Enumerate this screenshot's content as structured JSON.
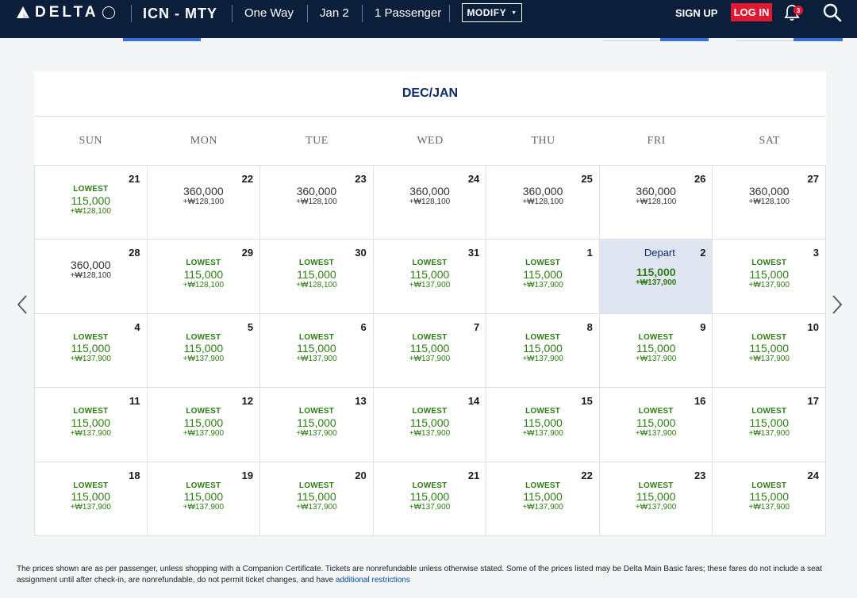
{
  "header": {
    "brand": "DELTA",
    "route": "ICN - MTY",
    "trip_type": "One Way",
    "date": "Jan 2",
    "passengers": "1 Passenger",
    "modify": "MODIFY",
    "signup": "SIGN UP",
    "login": "LOG IN",
    "notification_count": "3",
    "icons": [
      "delta-widget-icon",
      "delta-circle-icon",
      "bell-icon",
      "search-icon",
      "chevron-down-icon"
    ]
  },
  "calendar": {
    "month": "DEC/JAN",
    "days_of_week": [
      "SUN",
      "MON",
      "TUE",
      "WED",
      "THU",
      "FRI",
      "SAT"
    ],
    "lowest_label": "LOWEST",
    "selected_label": "Depart",
    "colors": {
      "green": "#2e7d14",
      "navy": "#0b2a6b",
      "selected_bg": "#dfe6f1"
    },
    "cells": [
      {
        "day": "21",
        "lowest": true,
        "miles": "115,000",
        "fee": "+₩128,100"
      },
      {
        "day": "22",
        "lowest": false,
        "miles": "360,000",
        "fee": "+₩128,100"
      },
      {
        "day": "23",
        "lowest": false,
        "miles": "360,000",
        "fee": "+₩128,100"
      },
      {
        "day": "24",
        "lowest": false,
        "miles": "360,000",
        "fee": "+₩128,100"
      },
      {
        "day": "25",
        "lowest": false,
        "miles": "360,000",
        "fee": "+₩128,100"
      },
      {
        "day": "26",
        "lowest": false,
        "miles": "360,000",
        "fee": "+₩128,100"
      },
      {
        "day": "27",
        "lowest": false,
        "miles": "360,000",
        "fee": "+₩128,100"
      },
      {
        "day": "28",
        "lowest": false,
        "miles": "360,000",
        "fee": "+₩128,100"
      },
      {
        "day": "29",
        "lowest": true,
        "miles": "115,000",
        "fee": "+₩128,100"
      },
      {
        "day": "30",
        "lowest": true,
        "miles": "115,000",
        "fee": "+₩128,100"
      },
      {
        "day": "31",
        "lowest": true,
        "miles": "115,000",
        "fee": "+₩137,900"
      },
      {
        "day": "1",
        "lowest": true,
        "miles": "115,000",
        "fee": "+₩137,900"
      },
      {
        "day": "2",
        "selected": true,
        "miles": "115,000",
        "fee": "+₩137,900"
      },
      {
        "day": "3",
        "lowest": true,
        "miles": "115,000",
        "fee": "+₩137,900"
      },
      {
        "day": "4",
        "lowest": true,
        "miles": "115,000",
        "fee": "+₩137,900"
      },
      {
        "day": "5",
        "lowest": true,
        "miles": "115,000",
        "fee": "+₩137,900"
      },
      {
        "day": "6",
        "lowest": true,
        "miles": "115,000",
        "fee": "+₩137,900"
      },
      {
        "day": "7",
        "lowest": true,
        "miles": "115,000",
        "fee": "+₩137,900"
      },
      {
        "day": "8",
        "lowest": true,
        "miles": "115,000",
        "fee": "+₩137,900"
      },
      {
        "day": "9",
        "lowest": true,
        "miles": "115,000",
        "fee": "+₩137,900"
      },
      {
        "day": "10",
        "lowest": true,
        "miles": "115,000",
        "fee": "+₩137,900"
      },
      {
        "day": "11",
        "lowest": true,
        "miles": "115,000",
        "fee": "+₩137,900"
      },
      {
        "day": "12",
        "lowest": true,
        "miles": "115,000",
        "fee": "+₩137,900"
      },
      {
        "day": "13",
        "lowest": true,
        "miles": "115,000",
        "fee": "+₩137,900"
      },
      {
        "day": "14",
        "lowest": true,
        "miles": "115,000",
        "fee": "+₩137,900"
      },
      {
        "day": "15",
        "lowest": true,
        "miles": "115,000",
        "fee": "+₩137,900"
      },
      {
        "day": "16",
        "lowest": true,
        "miles": "115,000",
        "fee": "+₩137,900"
      },
      {
        "day": "17",
        "lowest": true,
        "miles": "115,000",
        "fee": "+₩137,900"
      },
      {
        "day": "18",
        "lowest": true,
        "miles": "115,000",
        "fee": "+₩137,900"
      },
      {
        "day": "19",
        "lowest": true,
        "miles": "115,000",
        "fee": "+₩137,900"
      },
      {
        "day": "20",
        "lowest": true,
        "miles": "115,000",
        "fee": "+₩137,900"
      },
      {
        "day": "21",
        "lowest": true,
        "miles": "115,000",
        "fee": "+₩137,900"
      },
      {
        "day": "22",
        "lowest": true,
        "miles": "115,000",
        "fee": "+₩137,900"
      },
      {
        "day": "23",
        "lowest": true,
        "miles": "115,000",
        "fee": "+₩137,900"
      },
      {
        "day": "24",
        "lowest": true,
        "miles": "115,000",
        "fee": "+₩137,900"
      }
    ],
    "nav_icons": [
      "chevron-left-icon",
      "chevron-right-icon"
    ]
  },
  "footer": {
    "text": "The prices shown are as per passenger, unless shopping with a Companion Certificate. Tickets are nonrefundable unless otherwise stated. Some of the prices listed may be Delta Main Basic fares; these fares do not include a seat assignment until after check-in, are nonrefundable, do not permit ticket changes, and have ",
    "link": "additional restrictions"
  }
}
